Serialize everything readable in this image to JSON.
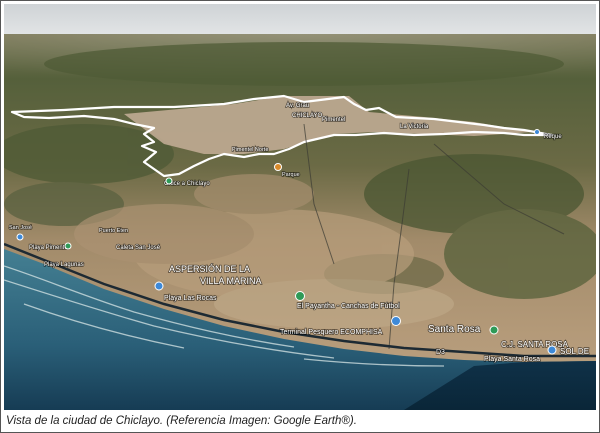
{
  "caption": "Vista de la ciudad de Chiclayo. (Referencia Imagen: Google Earth®).",
  "colors": {
    "sky_top": "#cfd3d6",
    "sky_bottom": "#e5e7e8",
    "vegetation": "#56623c",
    "desert": "#b49a79",
    "urban": "#c0ab93",
    "sea_near": "#1d4a63",
    "sea_far": "#447f92",
    "surf": "#d8e6e6",
    "boundary": "#ffffff",
    "pin_green": "#2e9a57",
    "pin_blue": "#3d89d8",
    "pin_orange": "#d98a2a"
  },
  "labels": {
    "city_area_1": "Av. Grau",
    "city_area_2": "CHICLAYO",
    "city_area_3": "Pimentel",
    "la_victoria": "La Victoria",
    "east_edge": "Reque",
    "west_edge": "San José",
    "mid_1": "Pimentel Norte",
    "mid_2": "Cruce a Chiclayo",
    "mid_3": "Parque",
    "coast_town": "Puerto Eten",
    "coast_1": "Playa Pimentel",
    "coast_2": "Caleta San José",
    "coast_3": "Playa Lagunas",
    "big_label_1": "ASPERSIÓN DE LA",
    "big_label_2": "VILLA MARINA",
    "beach_1": "Playa Las Rocas",
    "field": "El Payantha - Canchas de Fútbol",
    "terminal": "Terminal Pesquero ECOMPHISA",
    "santa_rosa": "Santa Rosa",
    "cj_santa_rosa": "C.J. SANTA ROSA",
    "road_code": "D3",
    "sol": "SOL DE",
    "playa_santa_rosa": "Playa Santa Rosa"
  }
}
